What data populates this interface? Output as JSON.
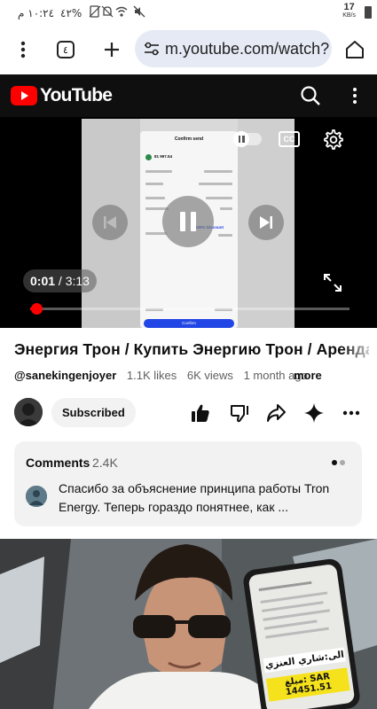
{
  "status_bar": {
    "time": "١٠:٢٤ م",
    "battery": "٤٢%",
    "net_speed": "17",
    "net_speed_unit": "KB/s"
  },
  "browser": {
    "tab_count": "٤",
    "url": "m.youtube.com/watch?"
  },
  "youtube": {
    "logo_text": "YouTube"
  },
  "player": {
    "current_time": "0:01",
    "separator": " / ",
    "duration": "3:13",
    "progress": 0.02,
    "is_playing": true,
    "captions_label": "CC",
    "frame_text": {
      "header": "Confirm send",
      "amount": "81 997.54",
      "discount": "100% Discount",
      "button": "Confirm"
    }
  },
  "video": {
    "title": "Энергия Трон / Купить Энергию Трон / Аренда",
    "channel": "@sanekingenjoyer",
    "likes": "1.1K likes",
    "views": "6K views",
    "age": "1 month ago",
    "more_label": "more",
    "subscribe_label": "Subscribed"
  },
  "comments": {
    "heading": "Comments",
    "count": "2.4K",
    "top_comment": "Спасибо за объяснение принципа работы Tron Energy. Теперь гораздо понятнее, как ..."
  },
  "next_video": {
    "overlay_label": "الى:شاري العنزي",
    "overlay_amount": "مبلغ: SAR 14451.51"
  },
  "colors": {
    "yt_red": "#ff0000",
    "yt_dark": "#0f0f0f",
    "url_pill": "#e5eaf5",
    "chip": "#f2f2f2"
  }
}
